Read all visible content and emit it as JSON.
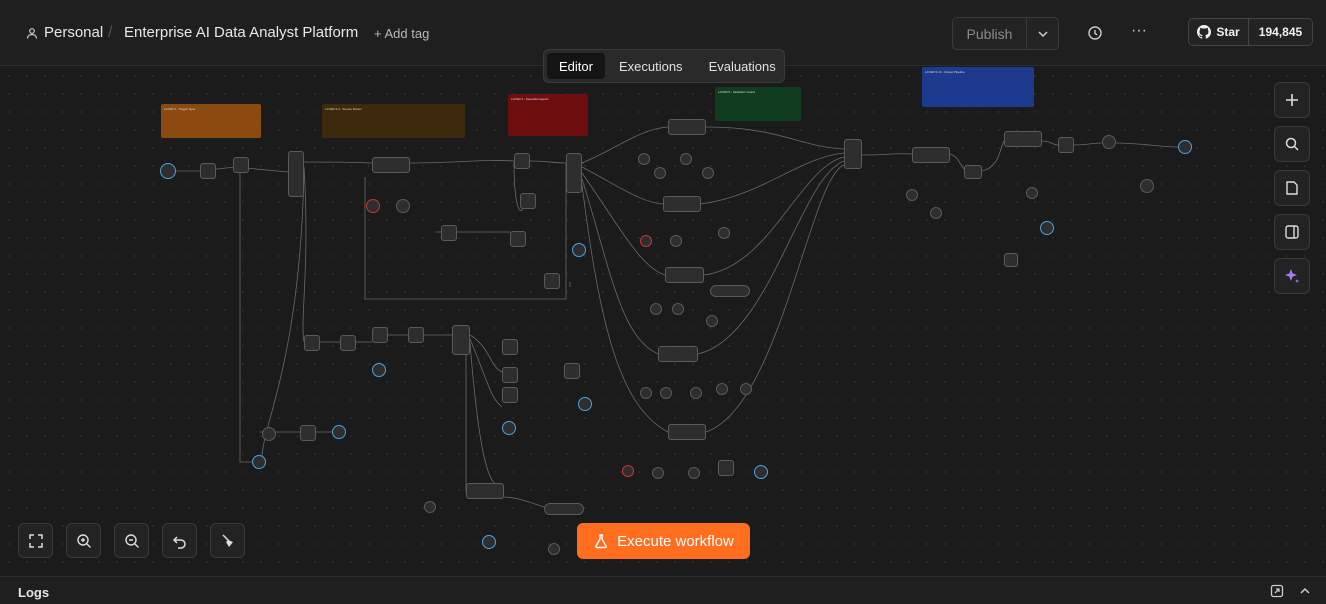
{
  "header": {
    "project": "Personal",
    "workflow_title": "Enterprise AI Data Analyst Platform",
    "add_tag": "+ Add tag",
    "publish_label": "Publish",
    "github_star": "Star",
    "github_count": "194,845"
  },
  "tabs": [
    {
      "label": "Editor",
      "active": true
    },
    {
      "label": "Executions",
      "active": false
    },
    {
      "label": "Evaluations",
      "active": false
    }
  ],
  "canvas": {
    "execute_label": "Execute workflow",
    "sticky_notes": [
      {
        "color": "#8a4a10",
        "title": "LAYER 1 - Trigger layer"
      },
      {
        "color": "#3d2a0d",
        "title": "LAYER 2-3 - Source Router"
      },
      {
        "color": "#6e0e0e",
        "title": "LAYER 4 - Specialist Agents"
      },
      {
        "color": "#0f3d1e",
        "title": "LAYER 5 - Validation Guard"
      },
      {
        "color": "#1e3a8f",
        "title": "LAYER 6-10 - Output Pipeline"
      }
    ]
  },
  "logs": {
    "label": "Logs"
  },
  "colors": {
    "accent": "#ff6d1f",
    "bg": "#1b1b1b"
  }
}
